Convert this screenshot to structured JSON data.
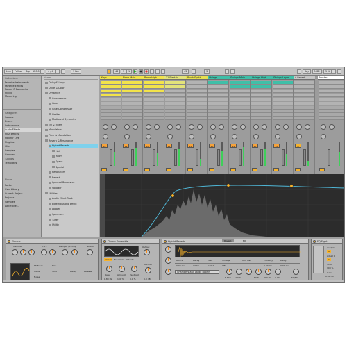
{
  "topbar": {
    "link": "Link",
    "follow": "Follow",
    "tap": "Tap",
    "tempo": "120.00",
    "signature": "4 / 4",
    "quant": "1 Bar",
    "pos1": "43",
    "pos2": "3",
    "pos3": "1",
    "key": "Key",
    "midi": "MIDI",
    "cpu": "5 %"
  },
  "leftpanel": {
    "collections_label": "Collections",
    "collections": [
      "Favorite Instruments",
      "Favorite Effects",
      "Drums & Percussion",
      "Mixing",
      "Mastering"
    ],
    "categories_label": "Categories",
    "categories": [
      "Sounds",
      "Drums",
      "Instruments",
      "Audio Effects",
      "MIDI Effects",
      "Max for Live",
      "Plug-ins",
      "Clips",
      "Samples",
      "Grooves",
      "Tunings",
      "Templates"
    ],
    "places_label": "Places",
    "places": [
      "Packs",
      "User Library",
      "Current Project",
      "Projects",
      "Samples",
      "Add Folder..."
    ]
  },
  "browser": {
    "header": "Name",
    "items": [
      {
        "label": "Delay & Loop",
        "indent": 0
      },
      {
        "label": "Drive & Color",
        "indent": 0
      },
      {
        "label": "Dynamics",
        "indent": 0
      },
      {
        "label": "Compressor",
        "indent": 1
      },
      {
        "label": "Gate",
        "indent": 1
      },
      {
        "label": "Glue Compressor",
        "indent": 1
      },
      {
        "label": "Limiter",
        "indent": 1
      },
      {
        "label": "Multiband Dynamics",
        "indent": 1
      },
      {
        "label": "EQ & Filters",
        "indent": 0
      },
      {
        "label": "Modulators",
        "indent": 0
      },
      {
        "label": "Pitch & Modulation",
        "indent": 0
      },
      {
        "label": "Reverb & Resonance",
        "indent": 0
      },
      {
        "label": "Hybrid Reverb",
        "indent": 1
      },
      {
        "label": "Hall",
        "indent": 2
      },
      {
        "label": "Room",
        "indent": 2
      },
      {
        "label": "Space",
        "indent": 2
      },
      {
        "label": "Special",
        "indent": 2
      },
      {
        "label": "Resonators",
        "indent": 1
      },
      {
        "label": "Reverb",
        "indent": 1
      },
      {
        "label": "Spectral Resonator",
        "indent": 1
      },
      {
        "label": "Vocoder",
        "indent": 1
      },
      {
        "label": "Utilities",
        "indent": 0
      },
      {
        "label": "Audio Effect Rack",
        "indent": 1
      },
      {
        "label": "External Audio Effect",
        "indent": 1
      },
      {
        "label": "Looper",
        "indent": 1
      },
      {
        "label": "Spectrum",
        "indent": 1
      },
      {
        "label": "Tuner",
        "indent": 1
      },
      {
        "label": "Utility",
        "indent": 1
      }
    ]
  },
  "tracks": [
    {
      "name": "Keys",
      "color": "#f2e34a",
      "vol": "18",
      "clips": [
        1,
        1,
        1,
        1,
        0,
        0
      ]
    },
    {
      "name": "Piano Main",
      "color": "#f2e34a",
      "vol": "19",
      "clips": [
        1,
        1,
        1,
        0,
        0,
        0
      ]
    },
    {
      "name": "Piano High",
      "color": "#f2e34a",
      "vol": "20",
      "clips": [
        1,
        1,
        1,
        0,
        0,
        0
      ]
    },
    {
      "name": "31 Electric",
      "color": "#e3e37a",
      "vol": "21",
      "clips": [
        1,
        1,
        0,
        0,
        0,
        0
      ]
    },
    {
      "name": "Pluck Synth",
      "color": "#e7e04f",
      "vol": "22",
      "clips": [
        0,
        0,
        0,
        0,
        0,
        0
      ]
    },
    {
      "name": "Strings",
      "color": "#3fbfa8",
      "vol": "23",
      "clips": [
        1,
        0,
        0,
        0,
        0,
        0
      ]
    },
    {
      "name": "Strings Main",
      "color": "#3fbfa8",
      "vol": "24",
      "clips": [
        1,
        1,
        0,
        0,
        0,
        0
      ]
    },
    {
      "name": "Strings High",
      "color": "#3fbfa8",
      "vol": "25",
      "clips": [
        1,
        1,
        0,
        0,
        0,
        0
      ]
    },
    {
      "name": "Strings Layer",
      "color": "#3fbfa8",
      "vol": "26",
      "clips": [
        1,
        0,
        0,
        0,
        0,
        0
      ]
    },
    {
      "name": "A Reverb",
      "color": "#c8c8c8",
      "vol": "A",
      "clips": [
        0,
        0,
        0,
        0,
        0,
        0
      ]
    },
    {
      "name": "Master",
      "color": "#ffffff",
      "vol": "",
      "clips": [
        0,
        0,
        0,
        0,
        0,
        0
      ]
    }
  ],
  "devices": {
    "electric": {
      "title": "Electric",
      "labels": [
        "Hammer",
        "Fork",
        "Damper / Pickup",
        "Global"
      ],
      "values": [
        "Stiffness",
        "Force",
        "Noise",
        "Tine",
        "Tone",
        "Decay",
        "Release"
      ]
    },
    "chorus": {
      "title": "Chorus-Ensemble",
      "modes": [
        "Classic",
        "Ensemble",
        "Vibrato"
      ],
      "labels": [
        "Rate",
        "Amount",
        "Feedback",
        "Output",
        "Warmth"
      ],
      "values": [
        "0.80 Hz",
        "100 %",
        "0.0 %",
        "0.0 dB"
      ]
    },
    "reverb": {
      "title": "Hybrid Reverb",
      "tabs": [
        "Reverb",
        "EQ"
      ],
      "algorithm": "Dark Hall",
      "ir": "Chambers and Large Rooms",
      "labels": [
        "Attack",
        "Decay",
        "Size",
        "Vintage",
        "Send",
        "Predelay",
        "Feedback",
        "Blend",
        "Decay",
        "Size",
        "Delay",
        "Shape",
        "Bass X",
        "Bass Mult"
      ],
      "values": [
        "0.00 ms",
        "17.0 s",
        "100 %",
        "Off",
        "0.0 dB",
        "0.00 ms",
        "0.0 %",
        "50/50",
        "5.60 s",
        "100 %",
        "0.00 ms",
        "50 %",
        "400 Hz",
        "1.00"
      ]
    },
    "eq": {
      "title": "EQ Eight",
      "labels": [
        "Analyze",
        "Adapt Q",
        "Scale",
        "Gain"
      ],
      "values": [
        "On",
        "On",
        "100 %",
        "0.00 dB"
      ]
    }
  },
  "colors": {
    "accent": "#f7b32b",
    "eq_curve": "#4fb6d6",
    "selection": "#7fd1ec"
  }
}
